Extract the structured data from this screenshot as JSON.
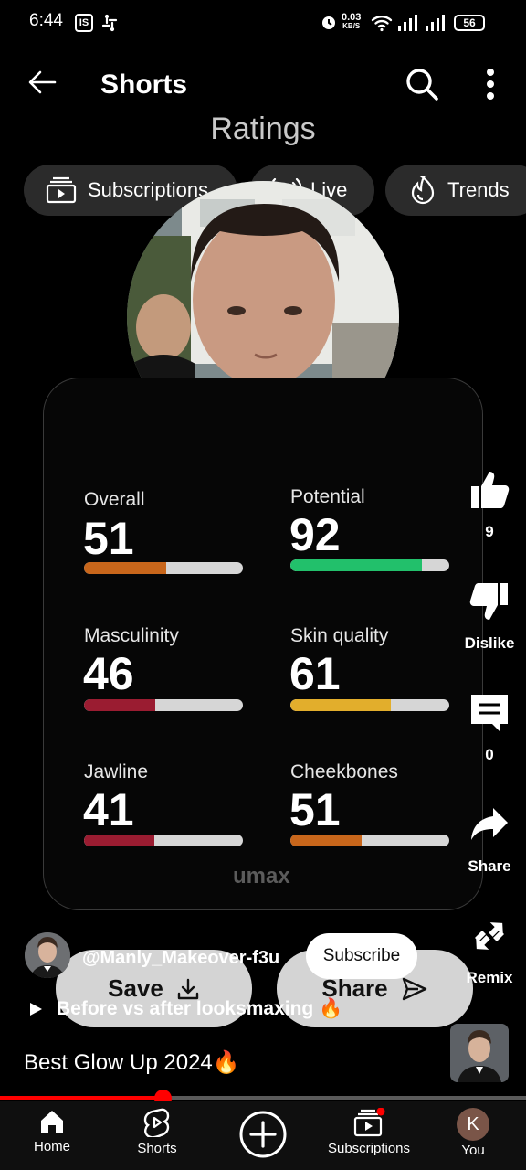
{
  "status_bar": {
    "time": "6:44",
    "badge_is": "IS",
    "net_speed_value": "0.03",
    "net_speed_unit": "KB/S",
    "battery": "56"
  },
  "header": {
    "title": "Shorts"
  },
  "video": {
    "overlay_title": "Ratings",
    "chips": [
      {
        "label": "Subscriptions",
        "icon": "subscriptions-icon"
      },
      {
        "label": "Live",
        "icon": "live-icon"
      },
      {
        "label": "Trends",
        "icon": "trends-icon"
      }
    ],
    "metrics": [
      {
        "label": "Overall",
        "value": "51",
        "fraction": 0.52,
        "color": "#c8661b"
      },
      {
        "label": "Potential",
        "value": "92",
        "fraction": 0.83,
        "color": "#22c06b"
      },
      {
        "label": "Masculinity",
        "value": "46",
        "fraction": 0.45,
        "color": "#9a1c31"
      },
      {
        "label": "Skin quality",
        "value": "61",
        "fraction": 0.63,
        "color": "#e2ae2c"
      },
      {
        "label": "Jawline",
        "value": "41",
        "fraction": 0.44,
        "color": "#9a1c31"
      },
      {
        "label": "Cheekbones",
        "value": "51",
        "fraction": 0.45,
        "color": "#c8661b"
      }
    ],
    "brand": "umax",
    "save_label": "Save",
    "share_label": "Share"
  },
  "actions": {
    "like_count": "9",
    "dislike_label": "Dislike",
    "comment_count": "0",
    "share_label": "Share",
    "remix_label": "Remix"
  },
  "channel": {
    "name": "@Manly_Makeover-f3u",
    "subscribe_label": "Subscribe",
    "caption": "Before vs after looksmaxing 🔥"
  },
  "video_title": "Best Glow Up 2024🔥",
  "progress": {
    "fraction": 0.31
  },
  "bottom_nav": {
    "items": [
      {
        "label": "Home",
        "icon": "home-icon"
      },
      {
        "label": "Shorts",
        "icon": "shorts-icon"
      },
      {
        "label": "",
        "icon": "create-icon"
      },
      {
        "label": "Subscriptions",
        "icon": "subscriptions-icon"
      },
      {
        "label": "You",
        "icon": "avatar"
      }
    ],
    "avatar_letter": "K"
  },
  "colors": {
    "accent_red": "#ff0000",
    "background": "#000000"
  }
}
